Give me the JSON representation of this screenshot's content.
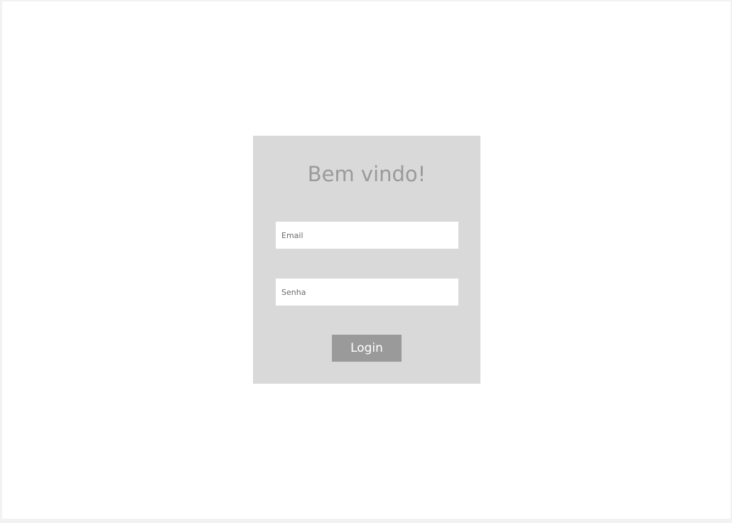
{
  "login": {
    "title": "Bem vindo!",
    "email_placeholder": "Email",
    "email_value": "",
    "password_placeholder": "Senha",
    "password_value": "",
    "button_label": "Login"
  },
  "colors": {
    "page_background": "#f2f2f2",
    "canvas_background": "#ffffff",
    "card_background": "#d9d9d9",
    "title_color": "#9a9a9a",
    "button_background": "#9a9a9a",
    "button_text": "#ffffff",
    "field_background": "#ffffff"
  }
}
